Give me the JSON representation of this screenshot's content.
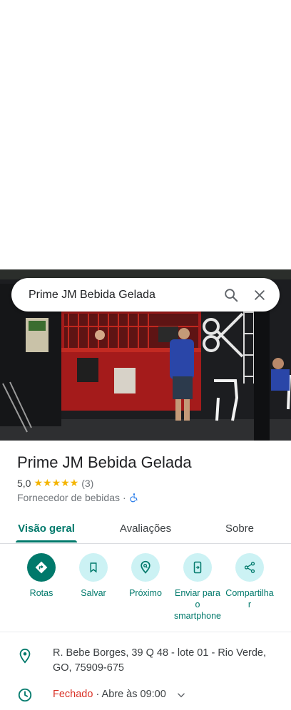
{
  "search": {
    "query": "Prime JM Bebida Gelada"
  },
  "place": {
    "name": "Prime JM Bebida Gelada",
    "rating": "5,0",
    "stars": "★★★★★",
    "review_count": "(3)",
    "category": "Fornecedor de bebidas",
    "separator": "·"
  },
  "tabs": [
    "Visão geral",
    "Avaliações",
    "Sobre"
  ],
  "actions": {
    "routes": "Rotas",
    "save": "Salvar",
    "nearby": "Próximo",
    "send_line1": "Enviar para",
    "send_line2": "o",
    "send_line3": "smartphone",
    "share_line1": "Compartilha",
    "share_line2": "r"
  },
  "address": "R. Bebe Borges, 39 Q 48 - lote 01 - Rio Verde, GO, 75909-675",
  "hours": {
    "status": "Fechado",
    "detail": "· Abre às 09:00"
  },
  "colors": {
    "accent": "#00796b",
    "accent_light": "#ccf2f4",
    "star": "#f4b400",
    "closed": "#d93025"
  }
}
